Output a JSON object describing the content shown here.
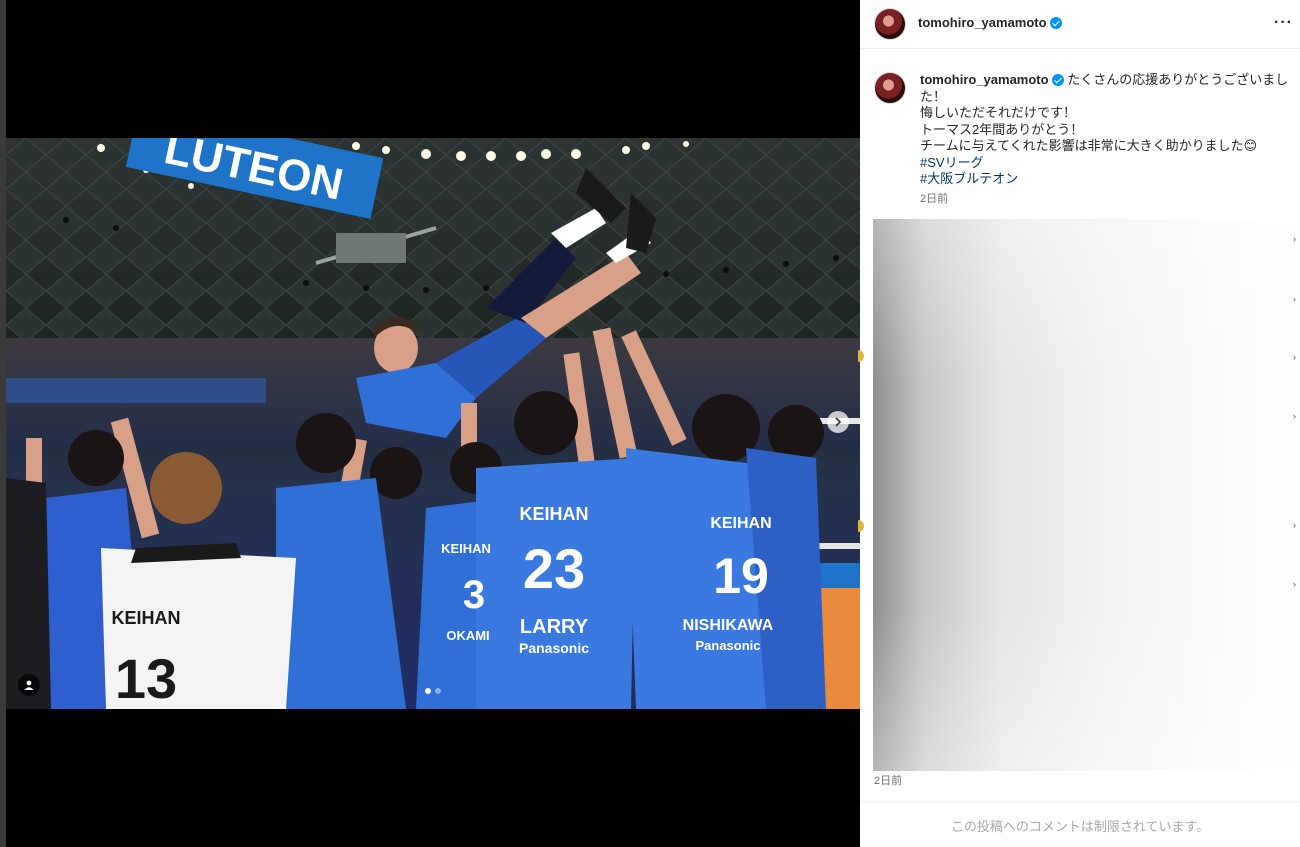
{
  "post": {
    "username": "tomohiro_yamamoto",
    "verified": true,
    "caption_lines": [
      "たくさんの応援ありがとうございまし",
      "た！",
      "悔しいただそれだけです！",
      "トーマス2年間ありがとう！",
      "チームに与えてくれた影響は非常に大きく助かりました😊"
    ],
    "hashtags": [
      "#SVリーグ",
      "#大阪ブルテオン"
    ],
    "caption_time": "2日前",
    "post_time": "2日前",
    "comments_restricted": "この投稿へのコメントは制限されています。"
  },
  "media": {
    "banner_text": "LUTEON",
    "carousel_count": 2,
    "carousel_active": 1,
    "jerseys": [
      {
        "brand": "KEIHAN",
        "number": "23",
        "name": "LARRY"
      },
      {
        "brand": "KEIHAN",
        "number": "19",
        "name": "NISHIKAWA"
      },
      {
        "brand": "KEIHAN",
        "number": "3",
        "name": "OKAMI"
      },
      {
        "brand": "KEIHAN",
        "number": "13",
        "name": ""
      }
    ],
    "sponsor": "Panasonic"
  },
  "icons": {
    "more": "more-horizontal-icon",
    "tag": "user-tag-icon",
    "next": "chevron-right-icon",
    "verified": "verified-badge-icon"
  },
  "colors": {
    "accent_link": "#00376b",
    "verified_blue": "#0095f6",
    "jersey_blue": "#2f6fd6"
  }
}
